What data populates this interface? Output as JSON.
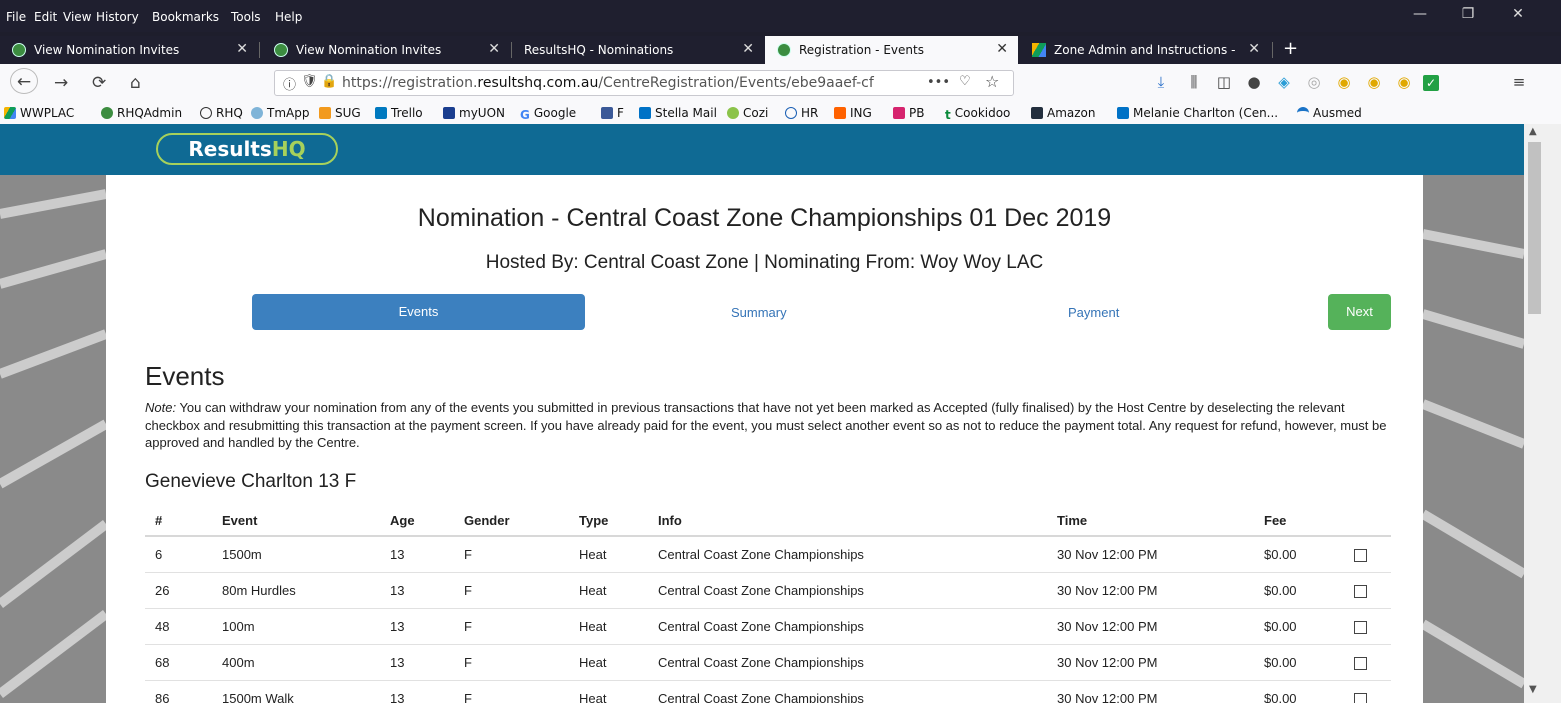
{
  "menu": [
    "File",
    "Edit",
    "View",
    "History",
    "Bookmarks",
    "Tools",
    "Help"
  ],
  "window_controls": {
    "minimize": "—",
    "restore": "❐",
    "close": "✕"
  },
  "tabs": [
    {
      "label": "View Nomination Invites",
      "active": false
    },
    {
      "label": "View Nomination Invites",
      "active": false
    },
    {
      "label": "ResultsHQ - Nominations",
      "active": false
    },
    {
      "label": "Registration - Events",
      "active": true
    },
    {
      "label": "Zone Admin and Instructions -",
      "active": false
    }
  ],
  "new_tab_label": "+",
  "navigation": {
    "back": "←",
    "forward": "→",
    "reload": "⟳",
    "home": "⌂",
    "url_host_prefix": "https://registration.",
    "url_domain": "resultshq.com.au",
    "url_path": "/CentreRegistration/Events/ebe9aaef-cf",
    "page_actions": "•••"
  },
  "bookmarks": [
    "WWPLAC",
    "RHQAdmin",
    "RHQ",
    "TmApp",
    "SUG",
    "Trello",
    "myUON",
    "Google",
    "F",
    "Stella Mail",
    "Cozi",
    "HR",
    "ING",
    "PB",
    "Cookidoo",
    "Amazon",
    "Melanie Charlton (Cen...",
    "Ausmed"
  ],
  "site": {
    "logo_text": "Results",
    "logo_accent": "HQ"
  },
  "page": {
    "title": "Nomination - Central Coast Zone Championships 01 Dec 2019",
    "subtitle": "Hosted By: Central Coast Zone | Nominating From: Woy Woy LAC",
    "steps": {
      "events": "Events",
      "summary": "Summary",
      "payment": "Payment"
    },
    "next_label": "Next",
    "section_heading": "Events",
    "note_label": "Note:",
    "note_text": " You can withdraw your nomination from any of the events you submitted in previous transactions that have not yet been marked as Accepted (fully finalised) by the Host Centre by deselecting the relevant checkbox and resubmitting this transaction at the payment screen. If you have already paid for the event, you must select another event so as not to reduce the payment total. Any request for refund, however, must be approved and handled by the Centre.",
    "athlete": "Genevieve Charlton 13 F"
  },
  "table": {
    "headers": {
      "num": "#",
      "event": "Event",
      "age": "Age",
      "gender": "Gender",
      "type": "Type",
      "info": "Info",
      "time": "Time",
      "fee": "Fee"
    },
    "rows": [
      {
        "num": "6",
        "event": "1500m",
        "age": "13",
        "gender": "F",
        "type": "Heat",
        "info": "Central Coast Zone Championships",
        "time": "30 Nov 12:00 PM",
        "fee": "$0.00",
        "checked": false
      },
      {
        "num": "26",
        "event": "80m Hurdles",
        "age": "13",
        "gender": "F",
        "type": "Heat",
        "info": "Central Coast Zone Championships",
        "time": "30 Nov 12:00 PM",
        "fee": "$0.00",
        "checked": false
      },
      {
        "num": "48",
        "event": "100m",
        "age": "13",
        "gender": "F",
        "type": "Heat",
        "info": "Central Coast Zone Championships",
        "time": "30 Nov 12:00 PM",
        "fee": "$0.00",
        "checked": false
      },
      {
        "num": "68",
        "event": "400m",
        "age": "13",
        "gender": "F",
        "type": "Heat",
        "info": "Central Coast Zone Championships",
        "time": "30 Nov 12:00 PM",
        "fee": "$0.00",
        "checked": false
      },
      {
        "num": "86",
        "event": "1500m Walk",
        "age": "13",
        "gender": "F",
        "type": "Heat",
        "info": "Central Coast Zone Championships",
        "time": "30 Nov 12:00 PM",
        "fee": "$0.00",
        "checked": false
      }
    ]
  },
  "colors": {
    "header_blue": "#0f6a94",
    "active_step": "#3c80bf",
    "next_green": "#55b25a",
    "logo_green": "#a6d15b"
  }
}
